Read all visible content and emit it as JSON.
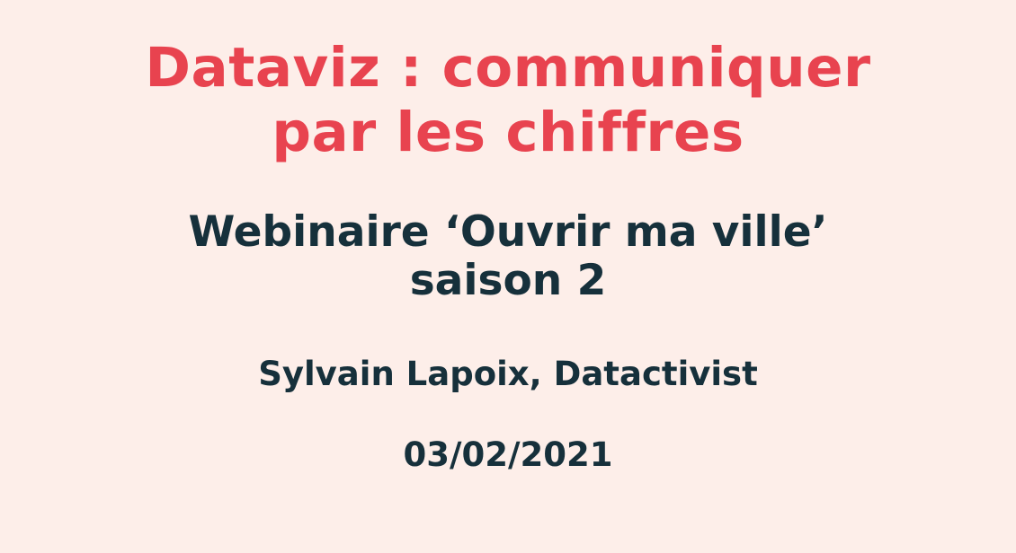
{
  "slide": {
    "title_lines": [
      "Dataviz : communiquer",
      "par les chiffres"
    ],
    "subtitle_lines": [
      "Webinaire ‘Ouvrir ma ville’",
      "saison 2"
    ],
    "author": "Sylvain Lapoix, Datactivist",
    "date": "03/02/2021"
  },
  "colors": {
    "background": "#fdeee9",
    "title": "#e8434f",
    "text": "#16303b"
  }
}
